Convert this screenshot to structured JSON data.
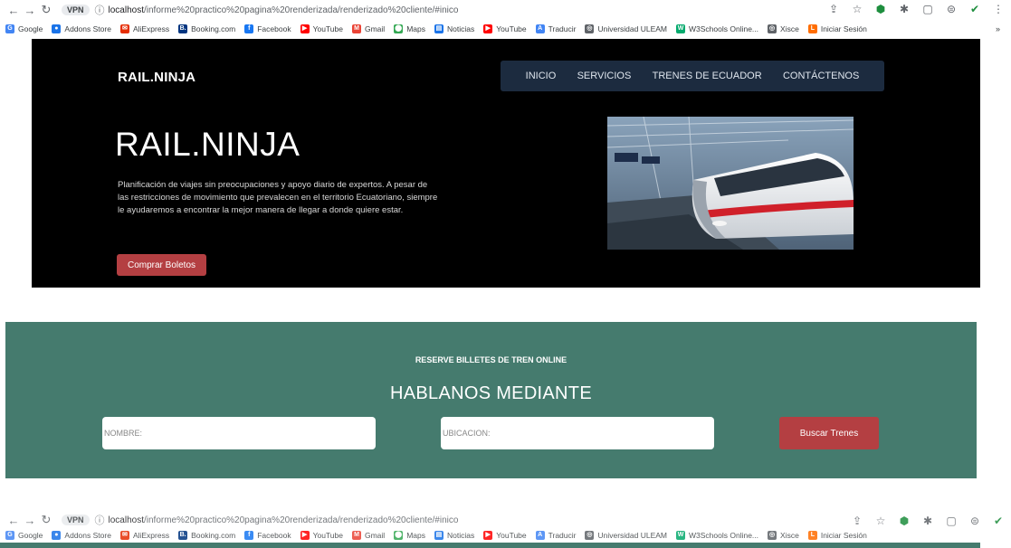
{
  "browser": {
    "site_chip": "VPN",
    "url_host": "localhost",
    "url_path": "/informe%20practico%20pagina%20renderizada/renderizado%20cliente/#inico",
    "bookmarks": [
      {
        "label": "Google",
        "color": "#4285f4",
        "glyph": "G"
      },
      {
        "label": "Addons Store",
        "color": "#1a73e8",
        "glyph": "●"
      },
      {
        "label": "AliExpress",
        "color": "#e62e04",
        "glyph": "✉"
      },
      {
        "label": "Booking.com",
        "color": "#003580",
        "glyph": "B."
      },
      {
        "label": "Facebook",
        "color": "#1877f2",
        "glyph": "f"
      },
      {
        "label": "YouTube",
        "color": "#ff0000",
        "glyph": "▶"
      },
      {
        "label": "Gmail",
        "color": "#ea4335",
        "glyph": "M"
      },
      {
        "label": "Maps",
        "color": "#34a853",
        "glyph": "⬤"
      },
      {
        "label": "Noticias",
        "color": "#1a73e8",
        "glyph": "▤"
      },
      {
        "label": "YouTube",
        "color": "#ff0000",
        "glyph": "▶"
      },
      {
        "label": "Traducir",
        "color": "#4285f4",
        "glyph": "A"
      },
      {
        "label": "Universidad ULEAM",
        "color": "#5f6368",
        "glyph": "◎"
      },
      {
        "label": "W3Schools Online...",
        "color": "#04aa6d",
        "glyph": "W"
      },
      {
        "label": "Xisce",
        "color": "#5f6368",
        "glyph": "◎"
      },
      {
        "label": "Iniciar Sesión",
        "color": "#ff6d00",
        "glyph": "L"
      }
    ]
  },
  "hero": {
    "brand": "RAIL.NINJA",
    "nav": [
      "INICIO",
      "SERVICIOS",
      "TRENES DE ECUADOR",
      "CONTÁCTENOS"
    ],
    "title": "RAIL.NINJA",
    "description": "Planificación de viajes sin preocupaciones y apoyo diario de expertos. A pesar de las restricciones de movimiento que prevalecen en el territorio Ecuatoriano, siempre le ayudaremos a encontrar la mejor manera de llegar a donde quiere estar.",
    "cta_label": "Comprar Boletos",
    "colors": {
      "background": "#000000",
      "nav_bg": "#1c2b3f",
      "accent": "#b43f42"
    }
  },
  "booking": {
    "eyebrow": "RESERVE BILLETES DE TREN ONLINE",
    "title": "HABLANOS MEDIANTE",
    "name_placeholder": "NOMBRE:",
    "location_placeholder": "UBICACION:",
    "search_label": "Buscar Trenes",
    "colors": {
      "background": "#457b6e",
      "button": "#b43f42"
    }
  }
}
